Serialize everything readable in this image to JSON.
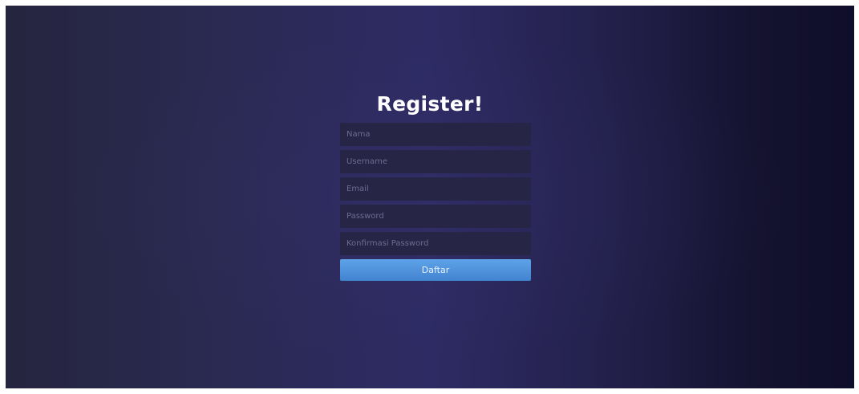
{
  "page": {
    "title": "Register!"
  },
  "form": {
    "fields": [
      {
        "name": "name",
        "placeholder": "Nama"
      },
      {
        "name": "username",
        "placeholder": "Username"
      },
      {
        "name": "email",
        "placeholder": "Email"
      },
      {
        "name": "password",
        "placeholder": "Password"
      },
      {
        "name": "confirm-password",
        "placeholder": "Konfirmasi Password"
      }
    ],
    "submit_label": "Daftar"
  },
  "colors": {
    "accent": "#4a8fdc",
    "background_dark": "#141330",
    "background_mid": "#2e2b64",
    "input_bg": "#262545"
  }
}
